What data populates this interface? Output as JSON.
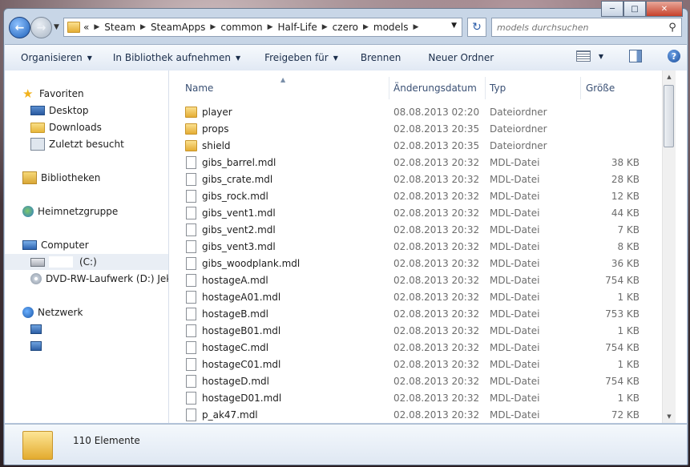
{
  "address": {
    "breadcrumb_prefix": "«",
    "crumbs": [
      "Steam",
      "SteamApps",
      "common",
      "Half-Life",
      "czero",
      "models"
    ]
  },
  "search": {
    "placeholder": "models durchsuchen"
  },
  "toolbar": {
    "organize": "Organisieren",
    "library": "In Bibliothek aufnehmen",
    "share": "Freigeben für",
    "burn": "Brennen",
    "new_folder": "Neuer Ordner",
    "help": "?"
  },
  "nav": {
    "favorites": "Favoriten",
    "desktop": "Desktop",
    "downloads": "Downloads",
    "recent": "Zuletzt besucht",
    "libraries": "Bibliotheken",
    "homegroup": "Heimnetzgruppe",
    "computer": "Computer",
    "drive_c": "(C:)",
    "dvd": "DVD-RW-Laufwerk (D:) Jeky",
    "network": "Netzwerk"
  },
  "columns": {
    "name": "Name",
    "date": "Änderungsdatum",
    "type": "Typ",
    "size": "Größe"
  },
  "files": [
    {
      "name": "player",
      "date": "08.08.2013 02:20",
      "type": "Dateiordner",
      "size": "",
      "kind": "folder"
    },
    {
      "name": "props",
      "date": "02.08.2013 20:35",
      "type": "Dateiordner",
      "size": "",
      "kind": "folder"
    },
    {
      "name": "shield",
      "date": "02.08.2013 20:35",
      "type": "Dateiordner",
      "size": "",
      "kind": "folder"
    },
    {
      "name": "gibs_barrel.mdl",
      "date": "02.08.2013 20:32",
      "type": "MDL-Datei",
      "size": "38 KB",
      "kind": "file"
    },
    {
      "name": "gibs_crate.mdl",
      "date": "02.08.2013 20:32",
      "type": "MDL-Datei",
      "size": "28 KB",
      "kind": "file"
    },
    {
      "name": "gibs_rock.mdl",
      "date": "02.08.2013 20:32",
      "type": "MDL-Datei",
      "size": "12 KB",
      "kind": "file"
    },
    {
      "name": "gibs_vent1.mdl",
      "date": "02.08.2013 20:32",
      "type": "MDL-Datei",
      "size": "44 KB",
      "kind": "file"
    },
    {
      "name": "gibs_vent2.mdl",
      "date": "02.08.2013 20:32",
      "type": "MDL-Datei",
      "size": "7 KB",
      "kind": "file"
    },
    {
      "name": "gibs_vent3.mdl",
      "date": "02.08.2013 20:32",
      "type": "MDL-Datei",
      "size": "8 KB",
      "kind": "file"
    },
    {
      "name": "gibs_woodplank.mdl",
      "date": "02.08.2013 20:32",
      "type": "MDL-Datei",
      "size": "36 KB",
      "kind": "file"
    },
    {
      "name": "hostageA.mdl",
      "date": "02.08.2013 20:32",
      "type": "MDL-Datei",
      "size": "754 KB",
      "kind": "file"
    },
    {
      "name": "hostageA01.mdl",
      "date": "02.08.2013 20:32",
      "type": "MDL-Datei",
      "size": "1 KB",
      "kind": "file"
    },
    {
      "name": "hostageB.mdl",
      "date": "02.08.2013 20:32",
      "type": "MDL-Datei",
      "size": "753 KB",
      "kind": "file"
    },
    {
      "name": "hostageB01.mdl",
      "date": "02.08.2013 20:32",
      "type": "MDL-Datei",
      "size": "1 KB",
      "kind": "file"
    },
    {
      "name": "hostageC.mdl",
      "date": "02.08.2013 20:32",
      "type": "MDL-Datei",
      "size": "754 KB",
      "kind": "file"
    },
    {
      "name": "hostageC01.mdl",
      "date": "02.08.2013 20:32",
      "type": "MDL-Datei",
      "size": "1 KB",
      "kind": "file"
    },
    {
      "name": "hostageD.mdl",
      "date": "02.08.2013 20:32",
      "type": "MDL-Datei",
      "size": "754 KB",
      "kind": "file"
    },
    {
      "name": "hostageD01.mdl",
      "date": "02.08.2013 20:32",
      "type": "MDL-Datei",
      "size": "1 KB",
      "kind": "file"
    },
    {
      "name": "p_ak47.mdl",
      "date": "02.08.2013 20:32",
      "type": "MDL-Datei",
      "size": "72 KB",
      "kind": "file"
    }
  ],
  "details": {
    "count": "110 Elemente"
  }
}
